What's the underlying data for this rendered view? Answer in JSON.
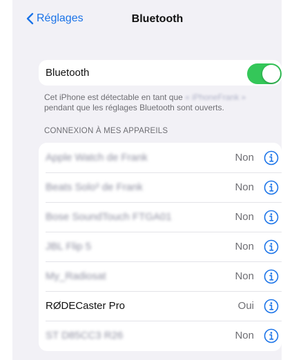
{
  "nav": {
    "back_label": "Réglages",
    "title": "Bluetooth"
  },
  "bluetooth": {
    "label": "Bluetooth",
    "enabled": true
  },
  "footer": {
    "text_before": "Cet iPhone est détectable en tant que ",
    "device_name": "« iPhoneFrank »",
    "text_after": " pendant que les réglages Bluetooth sont ouverts."
  },
  "section": {
    "header": "CONNEXION À MES APPAREILS"
  },
  "devices": [
    {
      "name": "Apple Watch de Frank",
      "status": "Non"
    },
    {
      "name": "Beats Solo³ de Frank",
      "status": "Non"
    },
    {
      "name": "Bose SoundTouch FTGA01",
      "status": "Non"
    },
    {
      "name": "JBL Flip 5",
      "status": "Non"
    },
    {
      "name": "My_Radiosat",
      "status": "Non"
    },
    {
      "name": "RØDECaster Pro",
      "status": "Oui"
    },
    {
      "name": "ST D85CC3 R26",
      "status": "Non"
    }
  ],
  "colors": {
    "accent": "#1a73e8",
    "toggle_on": "#34c759",
    "background": "#f2f1f6"
  }
}
